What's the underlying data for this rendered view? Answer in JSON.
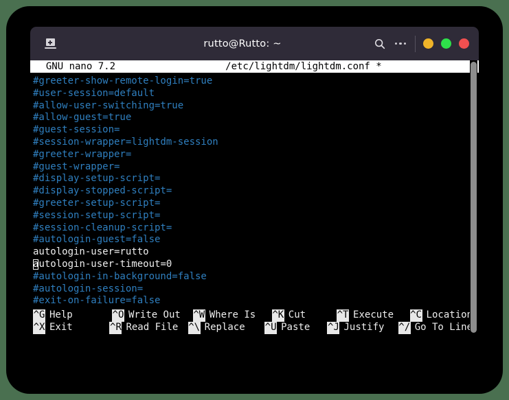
{
  "desktop": {
    "background_color": "#4a7050",
    "frame_color": "#000000"
  },
  "window": {
    "titlebar": {
      "background_color": "#2f2b38",
      "title": "rutto@Rutto: ~",
      "new_terminal_icon": "laptop-icon",
      "search_icon": "search-icon",
      "menu_icon": "ellipsis-icon",
      "controls": [
        {
          "name": "minimize",
          "color": "#f0b429"
        },
        {
          "name": "maximize",
          "color": "#2ee04a"
        },
        {
          "name": "close",
          "color": "#f05050"
        }
      ]
    }
  },
  "nano": {
    "header": {
      "version": "GNU nano 7.2",
      "filename": "/etc/lightdm/lightdm.conf *",
      "full_line": "  GNU nano 7.2                   /etc/lightdm/lightdm.conf *"
    },
    "lines": [
      {
        "text": "#greeter-show-remote-login=true",
        "style": "comment"
      },
      {
        "text": "#user-session=default",
        "style": "comment"
      },
      {
        "text": "#allow-user-switching=true",
        "style": "comment"
      },
      {
        "text": "#allow-guest=true",
        "style": "comment"
      },
      {
        "text": "#guest-session=",
        "style": "comment"
      },
      {
        "text": "#session-wrapper=lightdm-session",
        "style": "comment"
      },
      {
        "text": "#greeter-wrapper=",
        "style": "comment"
      },
      {
        "text": "#guest-wrapper=",
        "style": "comment"
      },
      {
        "text": "#display-setup-script=",
        "style": "comment"
      },
      {
        "text": "#display-stopped-script=",
        "style": "comment"
      },
      {
        "text": "#greeter-setup-script=",
        "style": "comment"
      },
      {
        "text": "#session-setup-script=",
        "style": "comment"
      },
      {
        "text": "#session-cleanup-script=",
        "style": "comment"
      },
      {
        "text": "#autologin-guest=false",
        "style": "comment"
      },
      {
        "text": "autologin-user=rutto",
        "style": "plain"
      },
      {
        "text": "autologin-user-timeout=0",
        "style": "plain",
        "cursor_at": 0
      },
      {
        "text": "#autologin-in-background=false",
        "style": "comment"
      },
      {
        "text": "#autologin-session=",
        "style": "comment"
      },
      {
        "text": "#exit-on-failure=false",
        "style": "comment"
      }
    ],
    "shortcuts": [
      {
        "key": "^G",
        "label": "Help",
        "key2": "^X",
        "label2": "Exit"
      },
      {
        "key": "^O",
        "label": "Write Out",
        "key2": "^R",
        "label2": "Read File"
      },
      {
        "key": "^W",
        "label": "Where Is",
        "key2": "^\\",
        "label2": "Replace"
      },
      {
        "key": "^K",
        "label": "Cut",
        "key2": "^U",
        "label2": "Paste"
      },
      {
        "key": "^T",
        "label": "Execute",
        "key2": "^J",
        "label2": "Justify"
      },
      {
        "key": "^C",
        "label": "Location",
        "key2": "^/",
        "label2": "Go To Line"
      }
    ],
    "colors": {
      "comment": "#2f7fbf",
      "plain": "#eeeeee",
      "background": "#000000",
      "header_background": "#ffffff",
      "scrollbar": "#8d8d8d"
    }
  }
}
